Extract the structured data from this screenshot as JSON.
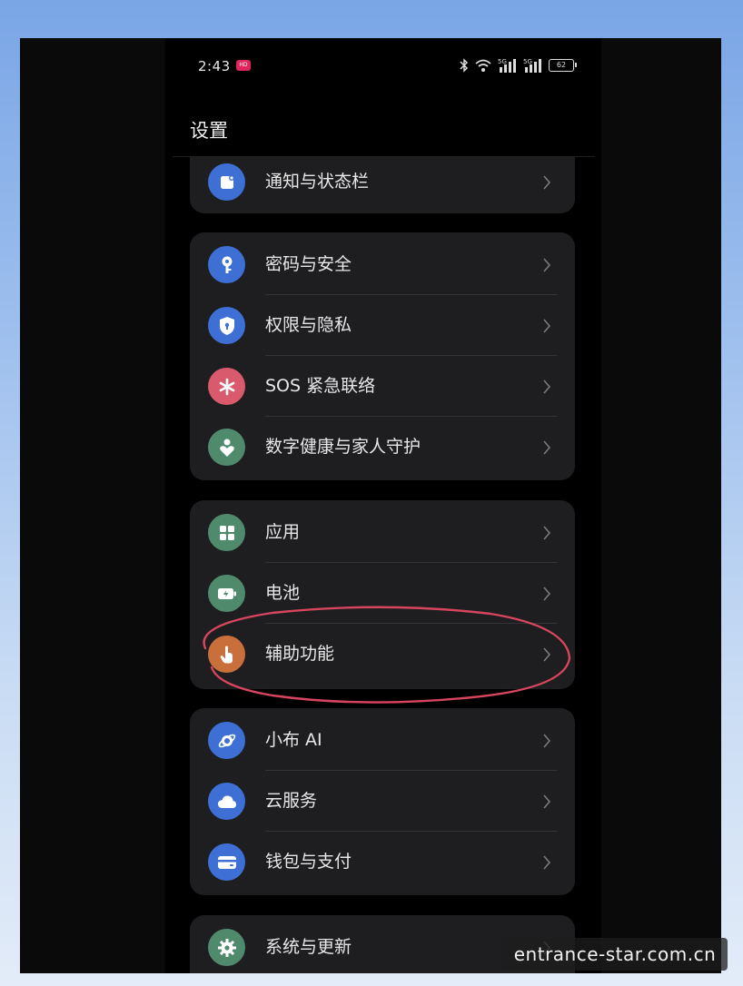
{
  "status_bar": {
    "time": "2:43",
    "notification_badge": "HD",
    "battery": "62",
    "network_1": "5G",
    "network_2": "5G"
  },
  "page_title": "设置",
  "groups": [
    {
      "items": [
        {
          "label": "通知与状态栏",
          "icon": "notification-icon",
          "icon_color": "#3d6fd4"
        }
      ]
    },
    {
      "items": [
        {
          "label": "密码与安全",
          "icon": "key-icon",
          "icon_color": "#3d6fd4"
        },
        {
          "label": "权限与隐私",
          "icon": "shield-icon",
          "icon_color": "#3d6fd4"
        },
        {
          "label": "SOS 紧急联络",
          "icon": "asterisk-icon",
          "icon_color": "#d85a6c"
        },
        {
          "label": "数字健康与家人守护",
          "icon": "heart-person-icon",
          "icon_color": "#4f8a6d"
        }
      ]
    },
    {
      "items": [
        {
          "label": "应用",
          "icon": "apps-grid-icon",
          "icon_color": "#4f8a6d"
        },
        {
          "label": "电池",
          "icon": "battery-icon",
          "icon_color": "#4f8a6d"
        },
        {
          "label": "辅助功能",
          "icon": "hand-touch-icon",
          "icon_color": "#c86f3c"
        }
      ]
    },
    {
      "items": [
        {
          "label": "小布 AI",
          "icon": "planet-icon",
          "icon_color": "#3d6fd4"
        },
        {
          "label": "云服务",
          "icon": "cloud-icon",
          "icon_color": "#3d6fd4"
        },
        {
          "label": "钱包与支付",
          "icon": "wallet-icon",
          "icon_color": "#3d6fd4"
        }
      ]
    },
    {
      "items": [
        {
          "label": "系统与更新",
          "icon": "gear-icon",
          "icon_color": "#4f8a6d"
        }
      ]
    }
  ],
  "watermark": "entrance-star.com.cn",
  "colors": {
    "annotation_stroke": "#d8455e",
    "card_background": "#1e1e20"
  }
}
